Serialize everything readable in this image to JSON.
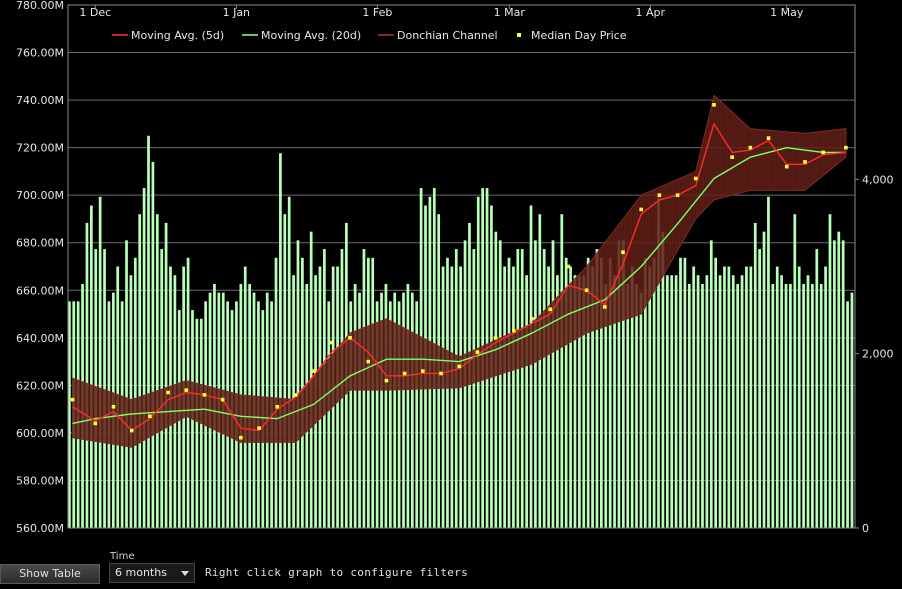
{
  "controls": {
    "show_table_label": "Show Table",
    "time_label": "Time",
    "time_value": "6 months",
    "hint": "Right click graph to configure filters"
  },
  "colors": {
    "ma5": "#ff2a2a",
    "ma20": "#7cff6a",
    "donchian_fill": "#5a1c14",
    "donchian_edge": "#7a2a20",
    "median": "#ffff33",
    "volume": "#b8ffb8",
    "grid": "#6a6a6a",
    "frame": "#8a8a8a"
  },
  "chart_data": {
    "type": "line",
    "title": "",
    "x_start": "2023-11-25",
    "x_end": "2024-05-16",
    "x_ticks": [
      {
        "label": "1 Dec",
        "date": "2023-12-01"
      },
      {
        "label": "1 Jan",
        "date": "2024-01-01"
      },
      {
        "label": "1 Feb",
        "date": "2024-02-01"
      },
      {
        "label": "1 Mar",
        "date": "2024-03-01"
      },
      {
        "label": "1 Apr",
        "date": "2024-04-01"
      },
      {
        "label": "1 May",
        "date": "2024-05-01"
      }
    ],
    "ylim": [
      560,
      780
    ],
    "y_ticks": [
      "560.00M",
      "580.00M",
      "600.00M",
      "620.00M",
      "640.00M",
      "660.00M",
      "680.00M",
      "700.00M",
      "720.00M",
      "740.00M",
      "760.00M",
      "780.00M"
    ],
    "y_tick_values": [
      560,
      580,
      600,
      620,
      640,
      660,
      680,
      700,
      720,
      740,
      760,
      780
    ],
    "volume_axis": {
      "ylim": [
        0,
        6000
      ],
      "ticks": [
        "0",
        "2,000",
        "4,000"
      ],
      "tick_values": [
        0,
        2000,
        4000
      ]
    },
    "legend": [
      {
        "name": "Moving Avg. (5d)",
        "kind": "line",
        "color": "#ff2a2a"
      },
      {
        "name": "Moving Avg. (20d)",
        "kind": "line",
        "color": "#7cff6a"
      },
      {
        "name": "Donchian Channel",
        "kind": "band",
        "color": "#7a2a20"
      },
      {
        "name": "Median Day Price",
        "kind": "dot",
        "color": "#ffff33"
      }
    ],
    "legend_position": "top-left",
    "grid": true,
    "series": [
      {
        "name": "Median Day Price",
        "x": [
          "2023-11-26",
          "2023-12-01",
          "2023-12-05",
          "2023-12-09",
          "2023-12-13",
          "2023-12-17",
          "2023-12-21",
          "2023-12-25",
          "2023-12-29",
          "2024-01-02",
          "2024-01-06",
          "2024-01-10",
          "2024-01-14",
          "2024-01-18",
          "2024-01-22",
          "2024-01-26",
          "2024-01-30",
          "2024-02-03",
          "2024-02-07",
          "2024-02-11",
          "2024-02-15",
          "2024-02-19",
          "2024-02-23",
          "2024-02-27",
          "2024-03-02",
          "2024-03-06",
          "2024-03-10",
          "2024-03-14",
          "2024-03-18",
          "2024-03-22",
          "2024-03-26",
          "2024-03-30",
          "2024-04-03",
          "2024-04-07",
          "2024-04-11",
          "2024-04-15",
          "2024-04-19",
          "2024-04-23",
          "2024-04-27",
          "2024-05-01",
          "2024-05-05",
          "2024-05-09",
          "2024-05-14"
        ],
        "values": [
          614,
          604,
          611,
          601,
          607,
          617,
          618,
          616,
          614,
          598,
          602,
          611,
          616,
          626,
          638,
          640,
          630,
          622,
          625,
          626,
          625,
          628,
          634,
          640,
          643,
          648,
          652,
          670,
          660,
          653,
          676,
          694,
          700,
          700,
          707,
          738,
          716,
          720,
          724,
          712,
          714,
          718,
          720
        ]
      },
      {
        "name": "Moving Avg. (5d)",
        "x": [
          "2023-11-26",
          "2023-12-01",
          "2023-12-05",
          "2023-12-09",
          "2023-12-13",
          "2023-12-17",
          "2023-12-21",
          "2023-12-25",
          "2023-12-29",
          "2024-01-02",
          "2024-01-06",
          "2024-01-10",
          "2024-01-14",
          "2024-01-18",
          "2024-01-22",
          "2024-01-26",
          "2024-01-30",
          "2024-02-03",
          "2024-02-07",
          "2024-02-11",
          "2024-02-15",
          "2024-02-19",
          "2024-02-23",
          "2024-02-27",
          "2024-03-02",
          "2024-03-06",
          "2024-03-10",
          "2024-03-14",
          "2024-03-18",
          "2024-03-22",
          "2024-03-26",
          "2024-03-30",
          "2024-04-03",
          "2024-04-07",
          "2024-04-11",
          "2024-04-15",
          "2024-04-19",
          "2024-04-23",
          "2024-04-27",
          "2024-05-01",
          "2024-05-05",
          "2024-05-09",
          "2024-05-14"
        ],
        "values": [
          611,
          605,
          609,
          601,
          606,
          614,
          617,
          616,
          614,
          602,
          601,
          610,
          615,
          624,
          634,
          640,
          634,
          624,
          624,
          625,
          625,
          627,
          633,
          638,
          642,
          646,
          650,
          662,
          660,
          654,
          671,
          692,
          698,
          700,
          704,
          730,
          718,
          719,
          723,
          713,
          713,
          717,
          718
        ]
      },
      {
        "name": "Moving Avg. (20d)",
        "x": [
          "2023-11-26",
          "2023-12-01",
          "2023-12-09",
          "2023-12-17",
          "2023-12-25",
          "2024-01-02",
          "2024-01-10",
          "2024-01-18",
          "2024-01-26",
          "2024-02-03",
          "2024-02-11",
          "2024-02-19",
          "2024-02-27",
          "2024-03-06",
          "2024-03-14",
          "2024-03-22",
          "2024-03-30",
          "2024-04-07",
          "2024-04-15",
          "2024-04-23",
          "2024-05-01",
          "2024-05-09",
          "2024-05-14"
        ],
        "values": [
          604,
          606,
          608,
          609,
          610,
          607,
          606,
          612,
          624,
          631,
          631,
          630,
          635,
          642,
          650,
          656,
          670,
          688,
          707,
          716,
          720,
          718,
          718
        ]
      },
      {
        "name": "Donchian Channel",
        "x": [
          "2023-11-26",
          "2023-12-09",
          "2023-12-21",
          "2024-01-02",
          "2024-01-14",
          "2024-01-26",
          "2024-02-03",
          "2024-02-19",
          "2024-03-06",
          "2024-03-18",
          "2024-03-30",
          "2024-04-11",
          "2024-04-15",
          "2024-04-23",
          "2024-05-05",
          "2024-05-14"
        ],
        "upper": [
          623,
          614,
          622,
          616,
          614,
          642,
          648,
          632,
          646,
          670,
          700,
          710,
          742,
          728,
          726,
          728
        ],
        "lower": [
          598,
          594,
          607,
          596,
          596,
          618,
          618,
          619,
          629,
          642,
          650,
          690,
          698,
          702,
          702,
          716
        ]
      }
    ],
    "volume": {
      "name": "Volume",
      "x_start": "2023-11-25",
      "x_end": "2024-05-16",
      "values": [
        2600,
        2600,
        2600,
        2800,
        3500,
        3700,
        3200,
        3800,
        3200,
        2600,
        2700,
        3000,
        2600,
        3300,
        2900,
        3100,
        3600,
        3900,
        4500,
        4200,
        3600,
        3200,
        3500,
        3000,
        2900,
        2500,
        3000,
        3100,
        2500,
        2400,
        2400,
        2600,
        2700,
        2800,
        2700,
        2700,
        2600,
        2500,
        2600,
        2800,
        3000,
        2800,
        2700,
        2600,
        2500,
        2700,
        2600,
        3100,
        4300,
        3600,
        3800,
        2900,
        3300,
        3100,
        2800,
        3400,
        2900,
        3000,
        3200,
        2600,
        3000,
        3000,
        3200,
        3500,
        2600,
        2800,
        2700,
        3200,
        3100,
        3100,
        2600,
        2700,
        2800,
        2600,
        2700,
        2600,
        2700,
        2800,
        2700,
        2600,
        3900,
        3700,
        3800,
        3900,
        3600,
        3000,
        3100,
        3000,
        3200,
        3000,
        3300,
        3500,
        3200,
        3800,
        3900,
        3900,
        3700,
        3400,
        3300,
        3000,
        3100,
        3000,
        3200,
        3200,
        2900,
        3700,
        3300,
        3600,
        3200,
        3000,
        3300,
        2900,
        3600,
        3100,
        3000,
        2900,
        2900,
        2900,
        3100,
        3000,
        3200,
        3100,
        2800,
        3100,
        2900,
        3300,
        3300,
        2800,
        3000,
        2800,
        2700,
        3100,
        3000,
        3100,
        3800,
        3400,
        2900,
        2900,
        2900,
        3100,
        3100,
        2800,
        3000,
        2900,
        2800,
        2900,
        3300,
        3100,
        2900,
        3000,
        3000,
        2900,
        2800,
        2900,
        3000,
        3000,
        3500,
        3200,
        3400,
        3800,
        2800,
        3000,
        2900,
        2800,
        2800,
        3600,
        3000,
        2800,
        2900,
        2800,
        3200,
        2800,
        3000,
        3600,
        3300,
        3400,
        3300,
        2600,
        2700
      ]
    }
  }
}
